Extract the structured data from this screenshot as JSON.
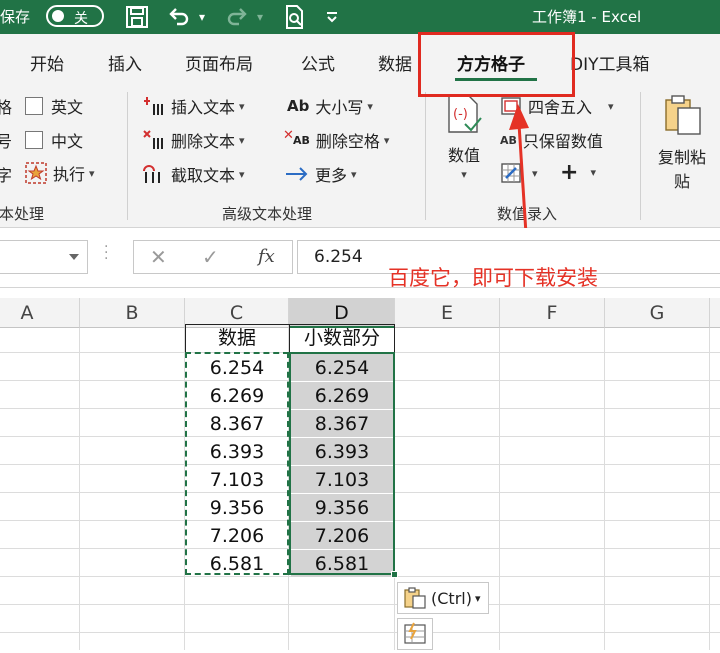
{
  "titlebar": {
    "autosave_label": "自动保存",
    "autosave_state": "关",
    "doc_title": "工作簿1  -  Excel"
  },
  "tabs": [
    {
      "label": "开始"
    },
    {
      "label": "插入"
    },
    {
      "label": "页面布局"
    },
    {
      "label": "公式"
    },
    {
      "label": "数据"
    },
    {
      "label": "方方格子",
      "active": true
    },
    {
      "label": "DIY工具箱"
    }
  ],
  "ribbon": {
    "text_group": {
      "label": "文本处理",
      "left_partial": [
        "格",
        "号",
        "字"
      ],
      "checkbox_english": "英文",
      "checkbox_chinese": "中文",
      "execute": "执行"
    },
    "advanced_group": {
      "label": "高级文本处理",
      "insert_text": "插入文本",
      "delete_text": "删除文本",
      "extract_text": "截取文本",
      "case": "大小写",
      "delete_spaces": "删除空格",
      "more": "更多",
      "case_icon": "Ab",
      "space_icon": "AB"
    },
    "numeric_group": {
      "label": "数值录入",
      "numeric": "数值",
      "round": "四舍五入",
      "keep_values": "只保留数值",
      "plus": "+"
    },
    "copy_paste": {
      "label_line1": "复制粘",
      "label_line2": "贴"
    }
  },
  "formula_bar": {
    "value": "6.254",
    "fx": "fx"
  },
  "annotation": "百度它，即可下载安装",
  "columns": [
    "A",
    "B",
    "C",
    "D",
    "E",
    "F",
    "G"
  ],
  "table": {
    "header_c": "数据",
    "header_d": "小数部分",
    "col_c": [
      "6.254",
      "6.269",
      "8.367",
      "6.393",
      "7.103",
      "9.356",
      "7.206",
      "6.581"
    ],
    "col_d": [
      "6.254",
      "6.269",
      "8.367",
      "6.393",
      "7.103",
      "9.356",
      "7.206",
      "6.581"
    ]
  },
  "paste_options": {
    "label": "(Ctrl)"
  },
  "colors": {
    "excel_green": "#217346",
    "annotation_red": "#e53226"
  }
}
